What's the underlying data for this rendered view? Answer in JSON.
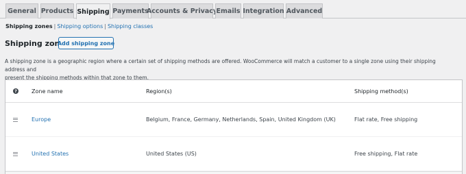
{
  "tabs": [
    {
      "label": "General",
      "active": false
    },
    {
      "label": "Products",
      "active": false
    },
    {
      "label": "Shipping",
      "active": true
    },
    {
      "label": "Payments",
      "active": false
    },
    {
      "label": "Accounts & Privacy",
      "active": false
    },
    {
      "label": "Emails",
      "active": false
    },
    {
      "label": "Integration",
      "active": false
    },
    {
      "label": "Advanced",
      "active": false
    }
  ],
  "subnav": {
    "current": "Shipping zones",
    "separator": "|",
    "links": [
      "Shipping options",
      "Shipping classes"
    ]
  },
  "section": {
    "title": "Shipping zones",
    "add_button": "Add shipping zone",
    "description_line1": "A shipping zone is a geographic region where a certain set of shipping methods are offered. WooCommerce will match a customer to a single zone using their shipping address and",
    "description_line2": "present the shipping methods within that zone to them."
  },
  "table": {
    "help_icon": "help-icon",
    "help_glyph": "?",
    "columns": [
      "Zone name",
      "Region(s)",
      "Shipping method(s)"
    ],
    "rows": [
      {
        "zone": "Europe",
        "regions": "Belgium, France, Germany, Netherlands, Spain, United Kingdom (UK)",
        "methods": "Flat rate, Free shipping"
      },
      {
        "zone": "United States",
        "regions": "United States (US)",
        "methods": "Free shipping, Flat rate"
      }
    ]
  },
  "colors": {
    "accent": "#2271b1",
    "background": "#f0f0f1",
    "text": "#3c434a"
  }
}
